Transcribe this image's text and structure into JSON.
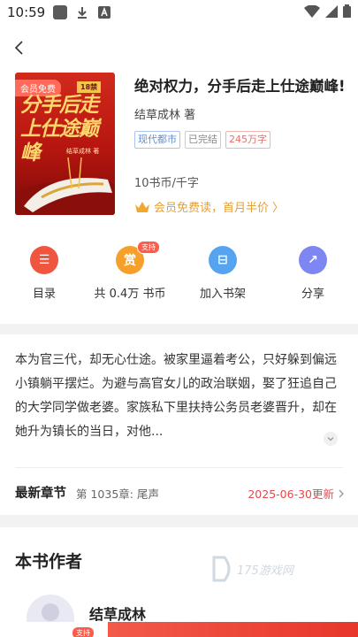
{
  "status_bar": {
    "time": "10:59"
  },
  "book": {
    "cover": {
      "vip_badge": "会员免费",
      "tag": "18禁",
      "title_art": "分手后走上仕途巅峰",
      "author_small": "结草成林 著"
    },
    "title": "绝对权力，分手后走上仕途巅峰!",
    "author": "结草成林 著",
    "tags": [
      "现代都市",
      "已完结",
      "245万字"
    ],
    "price": "10书币/千字",
    "vip_text": "会员免费读，首月半价",
    "vip_chevron": "〉"
  },
  "actions": [
    {
      "label": "目录",
      "glyph": "☰",
      "color": "#f0563f"
    },
    {
      "label": "共 0.4万 书币",
      "glyph": "赏",
      "color": "#f6a02b",
      "badge": "支持"
    },
    {
      "label": "加入书架",
      "glyph": "⊟",
      "color": "#56a3ef"
    },
    {
      "label": "分享",
      "glyph": "↗",
      "color": "#7e86f2"
    }
  ],
  "description": {
    "text": "本为官三代，却无心仕途。被家里逼着考公，只好躲到偏远小镇躺平摆烂。为避与高官女儿的政治联姻，娶了狂追自己的大学同学做老婆。家族私下里扶持公务员老婆晋升，却在她升为镇长的当日，对他..."
  },
  "latest": {
    "label": "最新章节",
    "chapter": "第 1035章: 尾声",
    "update": "2025-06-30更新"
  },
  "author_section": {
    "title": "本书作者",
    "author_name": "结草成林",
    "watermark": "175游戏网"
  },
  "bottom_bar": {
    "pill": "支持"
  }
}
